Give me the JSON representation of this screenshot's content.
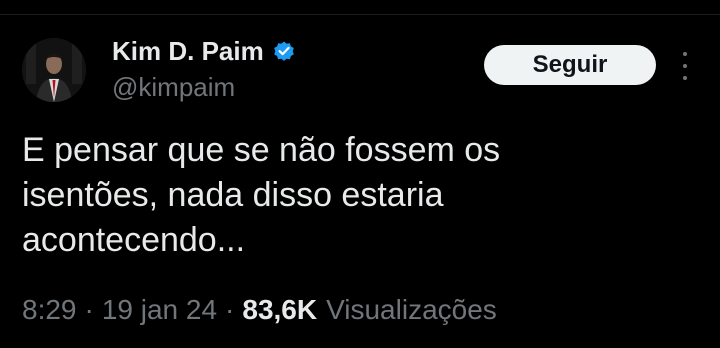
{
  "author": {
    "display_name": "Kim D. Paim",
    "handle": "@kimpaim",
    "verified": true,
    "verified_icon": "verified-badge-icon",
    "verified_color": "#1d9bf0"
  },
  "actions": {
    "follow_label": "Seguir",
    "more_icon": "more-vertical-icon"
  },
  "tweet": {
    "lines": [
      "E pensar que se não fossem os",
      "isentões, nada disso estaria",
      "acontecendo..."
    ]
  },
  "meta": {
    "time": "8:29",
    "separator": "·",
    "date": "19 jan 24",
    "views_count": "83,6K",
    "views_label": "Visualizações"
  },
  "colors": {
    "background": "#000000",
    "text_primary": "#e7e9ea",
    "text_secondary": "#71767b",
    "button_bg": "#eff3f4",
    "button_text": "#0f1419"
  }
}
